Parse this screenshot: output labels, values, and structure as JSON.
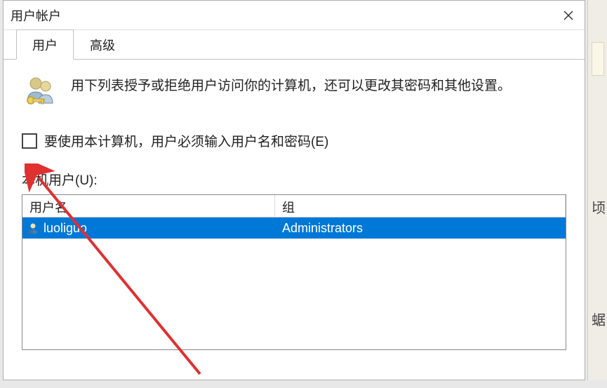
{
  "window": {
    "title": "用户帐户"
  },
  "tabs": {
    "user": "用户",
    "advanced": "高级"
  },
  "info": {
    "description": "用下列表授予或拒绝用户访问你的计算机，还可以更改其密码和其他设置。"
  },
  "checkbox": {
    "label": "要使用本计算机，用户必须输入用户名和密码(E)"
  },
  "users": {
    "label": "本机用户(U):",
    "headers": {
      "username": "用户名",
      "group": "组"
    },
    "rows": [
      {
        "username": "luoliguo",
        "group": "Administrators"
      }
    ]
  },
  "bg": {
    "t1": "顷",
    "t2": "蜛"
  }
}
